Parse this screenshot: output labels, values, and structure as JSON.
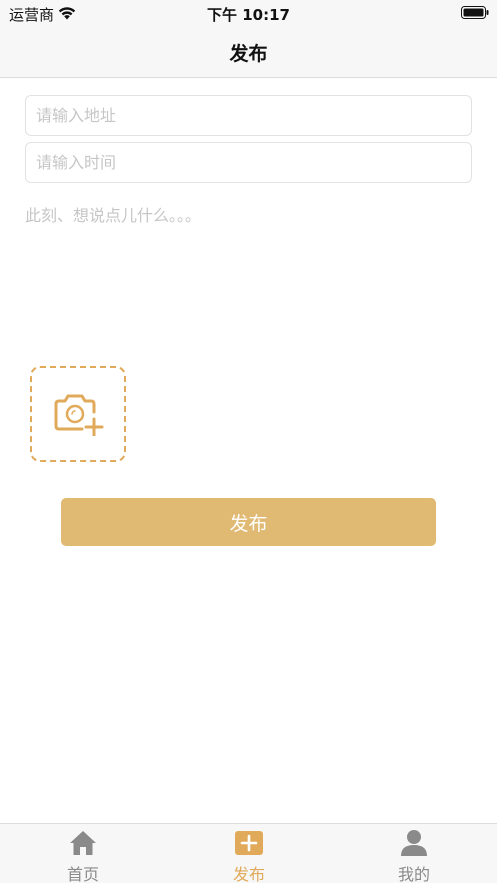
{
  "status_bar": {
    "carrier": "运营商",
    "time": "下午 10:17"
  },
  "nav": {
    "title": "发布"
  },
  "form": {
    "address_placeholder": "请输入地址",
    "address_value": "",
    "time_placeholder": "请输入时间",
    "time_value": "",
    "content_placeholder": "此刻、想说点儿什么。。。",
    "content_value": "",
    "photo_icon": "camera-add-icon",
    "publish_label": "发布"
  },
  "tab_bar": {
    "items": [
      {
        "label": "首页",
        "icon": "home-icon",
        "active": false
      },
      {
        "label": "发布",
        "icon": "plus-icon",
        "active": true
      },
      {
        "label": "我的",
        "icon": "user-icon",
        "active": false
      }
    ]
  },
  "colors": {
    "accent": "#e0aa5a",
    "button": "#e0b973",
    "inactive_tab": "#8a8a8a",
    "placeholder": "#c6c6c6"
  }
}
